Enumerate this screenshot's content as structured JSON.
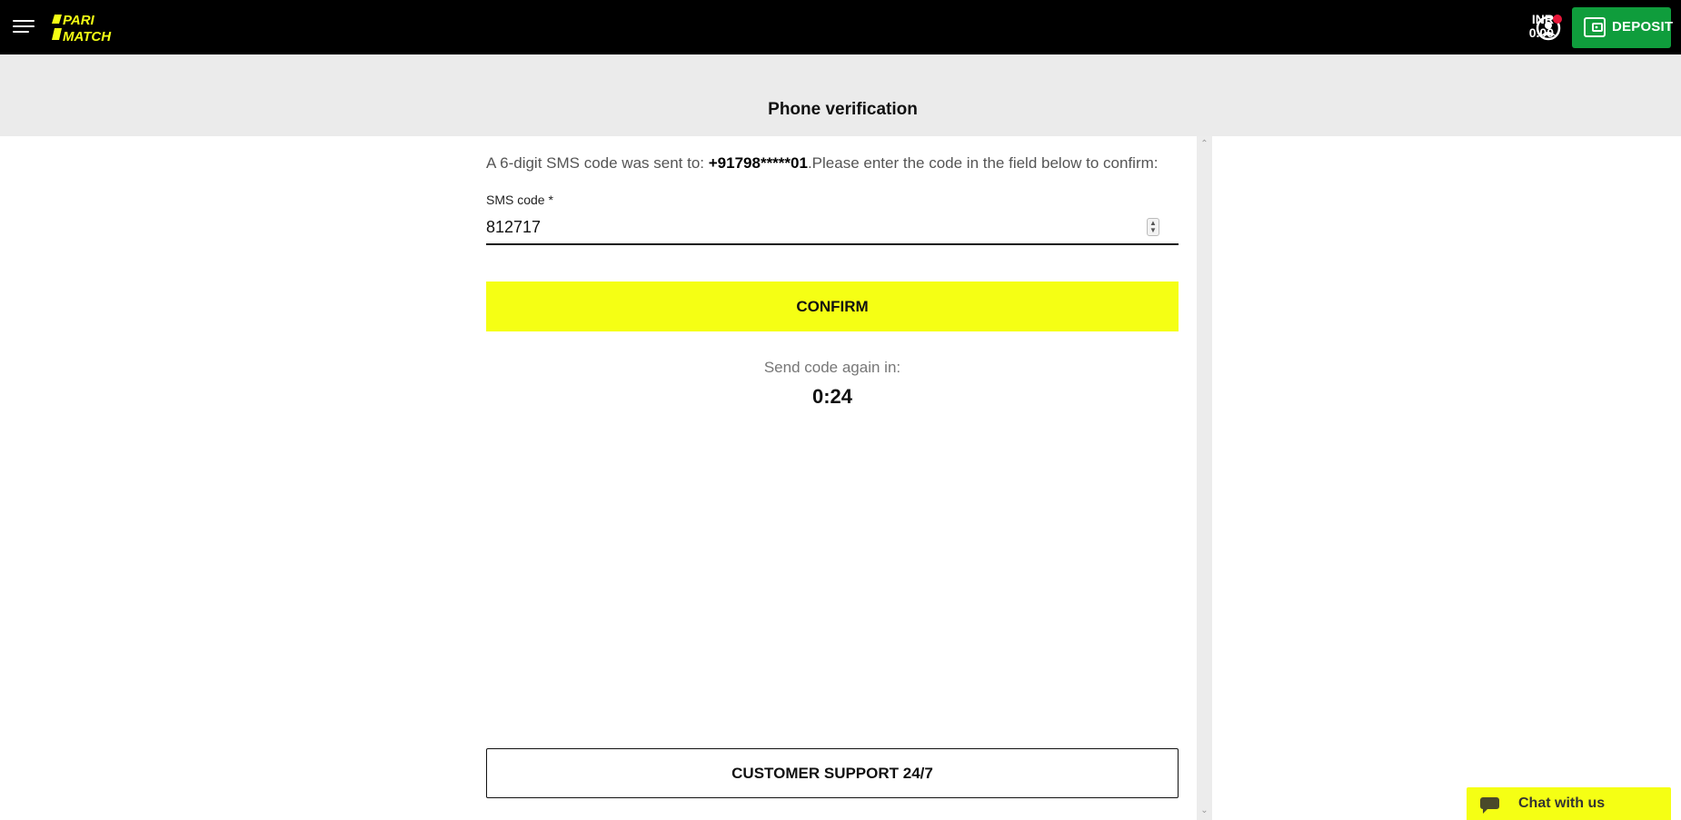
{
  "header": {
    "logo_top": "PARI",
    "logo_bottom": "MATCH",
    "currency": "INR",
    "balance": "0.00",
    "deposit_label": "DEPOSIT",
    "logo_color": "#f5ff14",
    "deposit_color": "#0f9d3c",
    "notification_color": "#e8173a"
  },
  "page": {
    "title": "Phone verification"
  },
  "verification": {
    "intro_prefix": "A 6-digit SMS code was sent to:",
    "phone": "+91798*****01",
    "intro_suffix": ".Please enter the code in the field below to confirm:",
    "field_label": "SMS code *",
    "code_value": "812717",
    "confirm_label": "CONFIRM",
    "resend_label": "Send code again in:",
    "timer": "0:24",
    "support_label": "CUSTOMER SUPPORT 24/7",
    "accent_color": "#f5ff14"
  },
  "chat": {
    "label": "Chat with us"
  },
  "icons": {
    "menu": "menu-icon",
    "profile": "user-icon",
    "wallet": "wallet-icon",
    "chat": "chat-bubble-icon"
  }
}
